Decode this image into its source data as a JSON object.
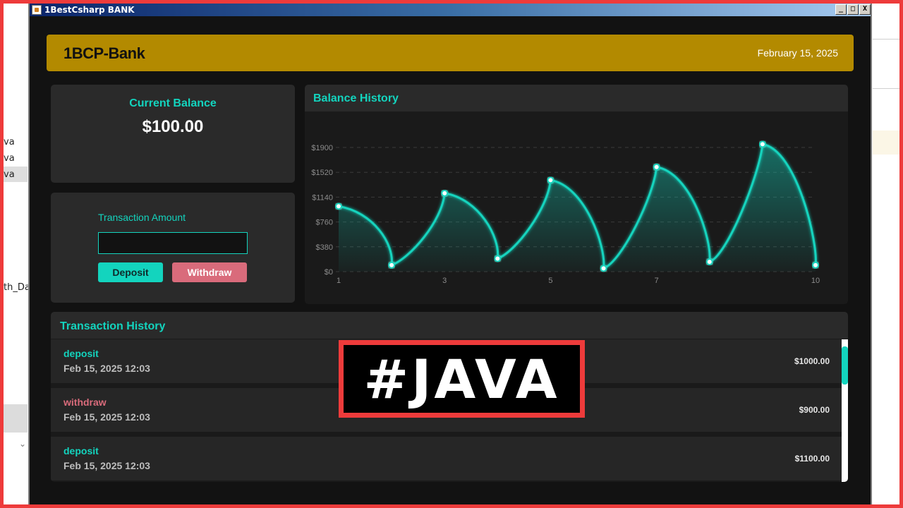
{
  "window": {
    "title": "1BestCsharp BANK",
    "buttons": [
      "_",
      "□",
      "X"
    ]
  },
  "background_ide": {
    "left_fragments": [
      "va",
      "va",
      "va",
      "th_Da"
    ]
  },
  "header": {
    "brand": "1BCP-Bank",
    "date": "February 15, 2025"
  },
  "balance": {
    "label": "Current Balance",
    "amount": "$100.00"
  },
  "transaction_form": {
    "amount_label": "Transaction Amount",
    "amount_value": "",
    "deposit_label": "Deposit",
    "withdraw_label": "Withdraw"
  },
  "balance_history": {
    "title": "Balance History"
  },
  "chart_data": {
    "type": "line",
    "title": "Balance History",
    "x": [
      1,
      2,
      3,
      4,
      5,
      6,
      7,
      8,
      9,
      10
    ],
    "x_tick_labels": [
      "1",
      "3",
      "5",
      "7",
      "10"
    ],
    "x_ticks": [
      1,
      3,
      5,
      7,
      10
    ],
    "y_tick_labels": [
      "$0",
      "$380",
      "$760",
      "$1140",
      "$1520",
      "$1900"
    ],
    "y_ticks": [
      0,
      380,
      760,
      1140,
      1520,
      1900
    ],
    "series": [
      {
        "values": [
          1000,
          100,
          1200,
          200,
          1400,
          50,
          1600,
          150,
          1950,
          100
        ]
      }
    ],
    "ylim": [
      0,
      1900
    ],
    "grid": true,
    "area_fill": true,
    "colors": {
      "line": "#13d4be",
      "area": "#13d4be"
    }
  },
  "transaction_history": {
    "title": "Transaction History",
    "rows": [
      {
        "type": "deposit",
        "date": "Feb 15, 2025 12:03",
        "amount": "$1000.00"
      },
      {
        "type": "withdraw",
        "date": "Feb 15, 2025 12:03",
        "amount": "$900.00"
      },
      {
        "type": "deposit",
        "date": "Feb 15, 2025 12:03",
        "amount": "$1100.00"
      }
    ]
  },
  "overlay": {
    "text": "#JAVA"
  },
  "colors": {
    "accent": "#13d4be",
    "header": "#b38a00",
    "withdraw": "#d96b7b",
    "frame": "#ee3b3b"
  }
}
